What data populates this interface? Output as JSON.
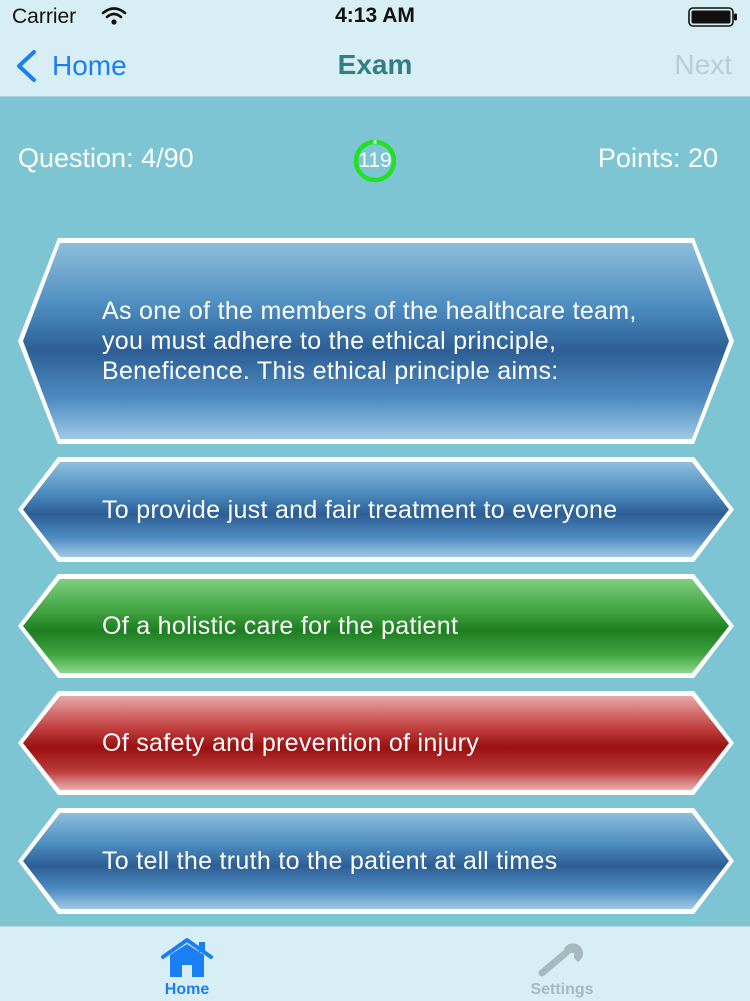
{
  "status_bar": {
    "carrier": "Carrier",
    "time": "4:13 AM"
  },
  "nav": {
    "back_label": "Home",
    "title": "Exam",
    "next_label": "Next"
  },
  "info": {
    "question_label": "Question: 4/90",
    "timer_value": "119",
    "points_label": "Points: 20"
  },
  "question": {
    "text": "As one of the members of the healthcare team, you must adhere to the ethical principle, Beneficence. This ethical principle aims:"
  },
  "answers": [
    {
      "text": "To provide just and fair treatment to everyone",
      "state": "default"
    },
    {
      "text": "Of a holistic care for the patient",
      "state": "correct"
    },
    {
      "text": "Of safety and prevention of injury",
      "state": "incorrect"
    },
    {
      "text": "To tell the truth to the patient at all times",
      "state": "default"
    }
  ],
  "tab_bar": {
    "items": [
      {
        "label": "Home",
        "icon": "house-icon",
        "selected": true
      },
      {
        "label": "Settings",
        "icon": "wrench-icon",
        "selected": false
      }
    ]
  },
  "colors": {
    "accent": "#1a7ff5",
    "background": "#7ec5d4",
    "bar_background": "#d6eef4",
    "timer_ring": "#22e022",
    "correct": "#2e8b2e",
    "incorrect": "#a31515",
    "default_answer": "#3b72a8"
  }
}
